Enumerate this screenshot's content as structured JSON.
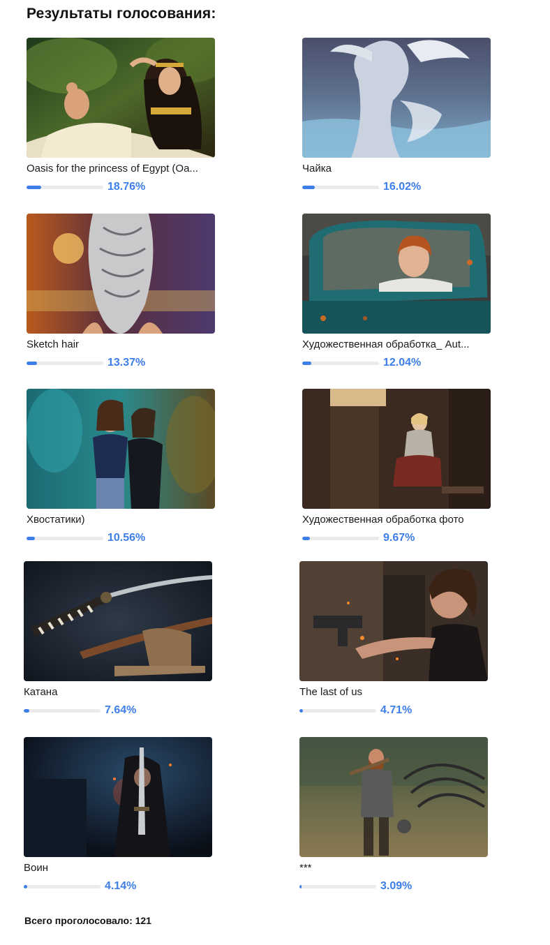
{
  "page": {
    "title": "Результаты голосования:"
  },
  "items": [
    {
      "name": "Oasis for the princess of Egypt (Oa...",
      "percent": "18.76%",
      "fraction": 0.1876,
      "image": "egyptian-princess-image"
    },
    {
      "name": "Чайка",
      "percent": "16.02%",
      "fraction": 0.1602,
      "image": "seagull-woman-image"
    },
    {
      "name": "Sketch hair",
      "percent": "13.37%",
      "fraction": 0.1337,
      "image": "braided-hair-image"
    },
    {
      "name": "Художественная обработка_ Aut...",
      "percent": "12.04%",
      "fraction": 0.1204,
      "image": "girl-in-car-image"
    },
    {
      "name": "Хвостатики)",
      "percent": "10.56%",
      "fraction": 0.1056,
      "image": "fantasy-couple-image"
    },
    {
      "name": "Художественная обработка фото",
      "percent": "9.67%",
      "fraction": 0.0967,
      "image": "girl-by-window-image"
    },
    {
      "name": "Катана",
      "percent": "7.64%",
      "fraction": 0.0764,
      "image": "katana-image"
    },
    {
      "name": "The last of us",
      "percent": "4.71%",
      "fraction": 0.0471,
      "image": "woman-with-gun-image"
    },
    {
      "name": "Воин",
      "percent": "4.14%",
      "fraction": 0.0414,
      "image": "hooded-warrior-image"
    },
    {
      "name": "***",
      "percent": "3.09%",
      "fraction": 0.0309,
      "image": "viking-warrior-image"
    }
  ],
  "footer": {
    "total_text": "Всего проголосовало: 121"
  }
}
